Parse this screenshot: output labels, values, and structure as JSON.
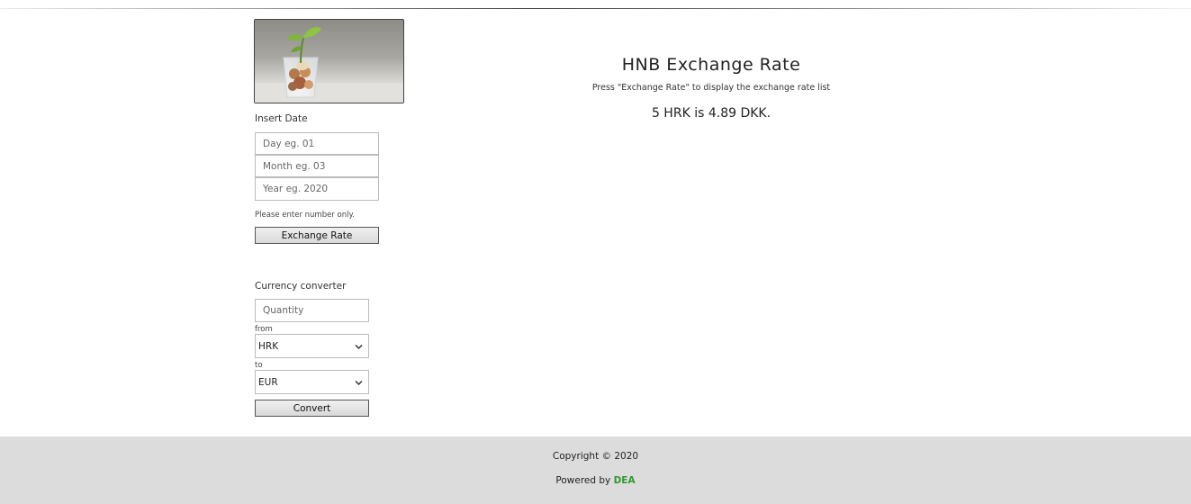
{
  "sidebar": {
    "insert_date_label": "Insert Date",
    "day_placeholder": "Day eg. 01",
    "month_placeholder": "Month eg. 03",
    "year_placeholder": "Year eg. 2020",
    "hint": "Please enter number only.",
    "exchange_rate_button": "Exchange Rate",
    "converter_label": "Currency converter",
    "quantity_placeholder": "Quantity",
    "from_label": "from",
    "from_value": "HRK",
    "to_label": "to",
    "to_value": "EUR",
    "convert_button": "Convert"
  },
  "main": {
    "title": "HNB Exchange Rate",
    "subtitle": "Press \"Exchange Rate\" to display the exchange rate list",
    "result": "5 HRK is 4.89 DKK."
  },
  "footer": {
    "copyright": "Copyright © 2020",
    "powered_prefix": "Powered by ",
    "powered_brand": "DEA"
  },
  "colors": {
    "footer_bg": "#dcdcdc",
    "brand": "#2e9a2e"
  }
}
